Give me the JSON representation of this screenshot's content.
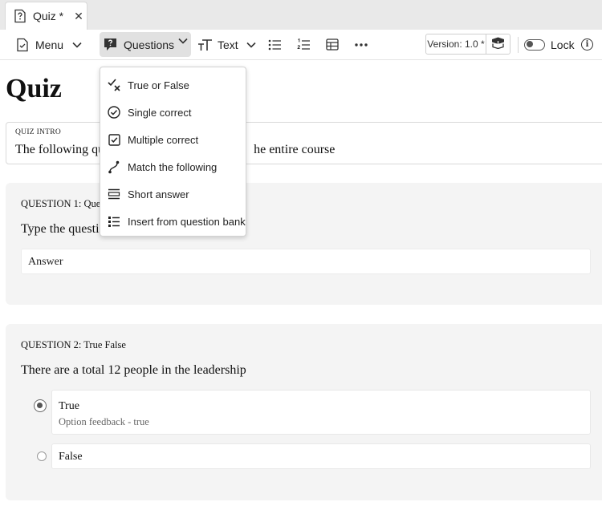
{
  "tab": {
    "title": "Quiz *",
    "close": "✕"
  },
  "toolbar": {
    "menu_label": "Menu",
    "questions_label": "Questions",
    "text_label": "Text",
    "version_label": "Version: 1.0 *",
    "lock_label": "Lock",
    "info": "i"
  },
  "questions_menu": {
    "items": [
      {
        "label": "True or False",
        "icon": "true-false-icon"
      },
      {
        "label": "Single correct",
        "icon": "check-circle-icon"
      },
      {
        "label": "Multiple correct",
        "icon": "checkbox-icon"
      },
      {
        "label": "Match the following",
        "icon": "match-curve-icon"
      },
      {
        "label": "Short answer",
        "icon": "short-answer-icon"
      },
      {
        "label": "Insert from question bank",
        "icon": "list-bank-icon"
      }
    ]
  },
  "page": {
    "title": "Quiz",
    "intro_caption": "QUIZ INTRO",
    "intro_text": "The following qu",
    "intro_text_tail": "he entire course"
  },
  "question1": {
    "header": "QUESTION 1: Que",
    "text": "Type the questio",
    "answer_placeholder": "Answer"
  },
  "question2": {
    "header": "QUESTION 2: True False",
    "text": "There are a total 12 people in the leadership",
    "options": [
      {
        "label": "True",
        "feedback": "Option feedback - true",
        "selected": true
      },
      {
        "label": "False",
        "selected": false
      }
    ]
  },
  "colors": {
    "tabbar_bg": "#e9e9e9",
    "active_button_bg": "#e1e1e1",
    "card_bg": "#f4f4f4"
  }
}
